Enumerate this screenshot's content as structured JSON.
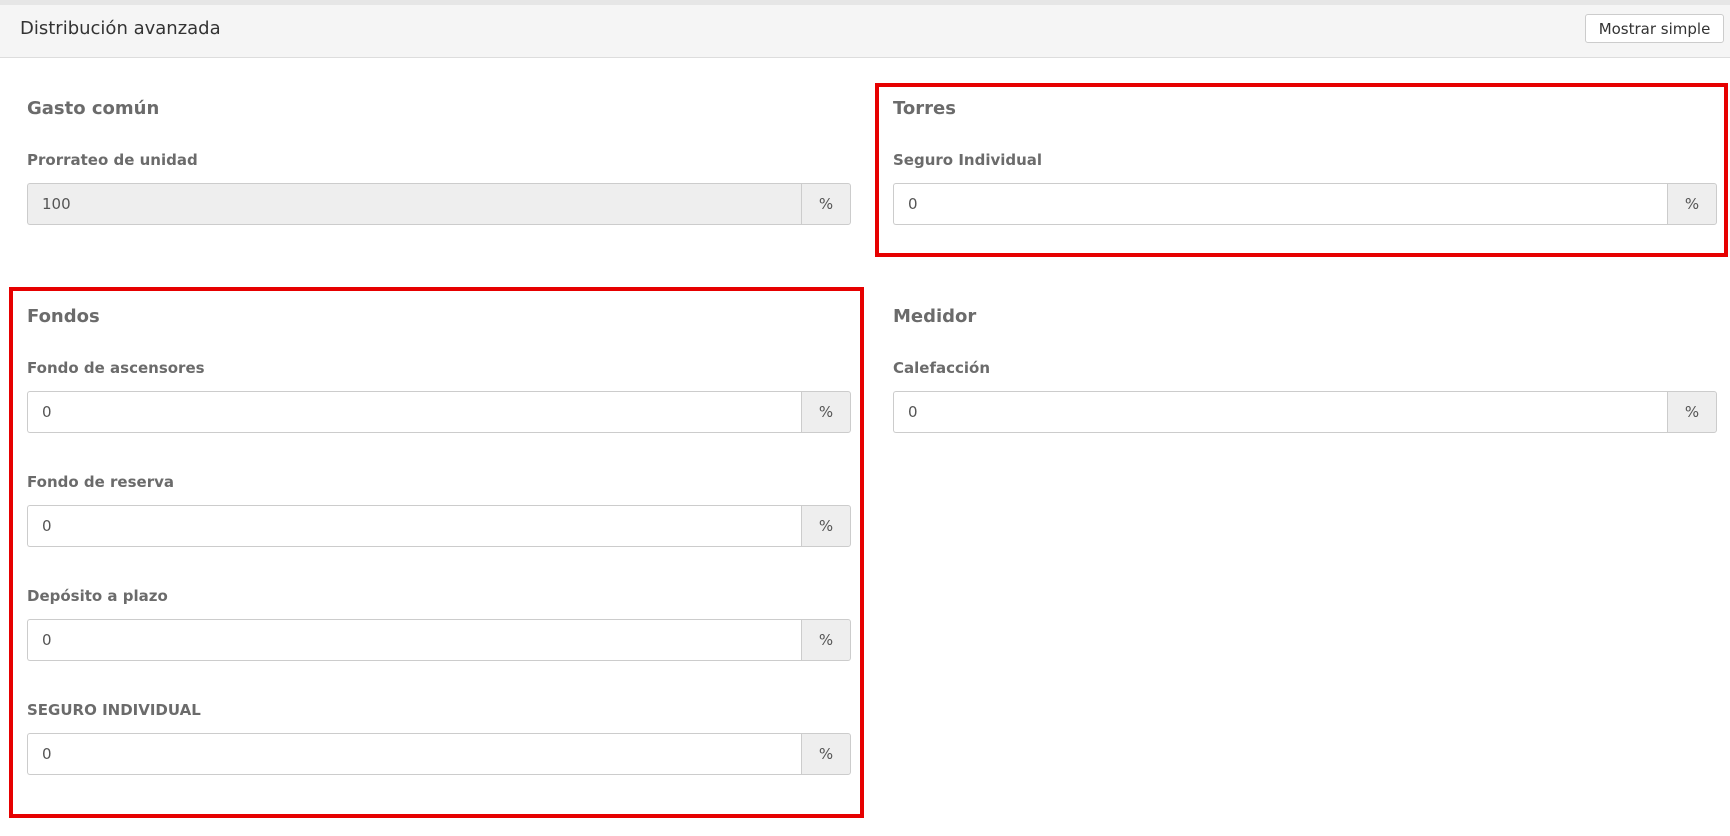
{
  "header": {
    "title": "Distribución avanzada",
    "toggle_label": "Mostrar simple"
  },
  "sections": {
    "gasto_comun": {
      "title": "Gasto común",
      "fields": [
        {
          "label": "Prorrateo de unidad",
          "value": "100",
          "addon": "%",
          "readonly": true
        }
      ]
    },
    "torres": {
      "title": "Torres",
      "fields": [
        {
          "label": "Seguro Individual",
          "value": "0",
          "addon": "%"
        }
      ]
    },
    "fondos": {
      "title": "Fondos",
      "fields": [
        {
          "label": "Fondo de ascensores",
          "value": "0",
          "addon": "%"
        },
        {
          "label": "Fondo de reserva",
          "value": "0",
          "addon": "%"
        },
        {
          "label": "Depósito a plazo",
          "value": "0",
          "addon": "%"
        },
        {
          "label": "SEGURO INDIVIDUAL",
          "value": "0",
          "addon": "%"
        }
      ]
    },
    "medidor": {
      "title": "Medidor",
      "fields": [
        {
          "label": "Calefacción",
          "value": "0",
          "addon": "%"
        }
      ]
    }
  },
  "colors": {
    "highlight": "#e60000",
    "header_bg": "#f5f5f5",
    "addon_bg": "#eeeeee"
  }
}
